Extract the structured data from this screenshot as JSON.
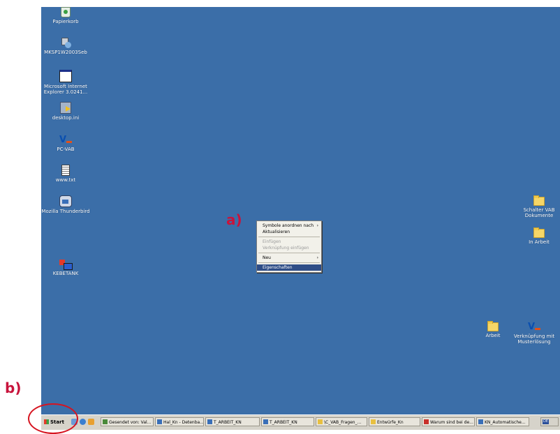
{
  "desktop_icons_left": [
    {
      "label": "Papierkorb",
      "icon": "recycle-bin-icon"
    },
    {
      "label": "MKSP1W2003Seb",
      "icon": "network-computer-icon"
    },
    {
      "label": "Microsoft Internet Explorer 3.0241...",
      "icon": "application-window-icon"
    },
    {
      "label": "desktop.ini",
      "icon": "config-file-icon"
    },
    {
      "label": "PC-VAB",
      "icon": "vr-bank-icon"
    },
    {
      "label": "www.txt",
      "icon": "text-file-icon"
    },
    {
      "label": "Mozilla Thunderbird",
      "icon": "thunderbird-icon"
    },
    {
      "label": "KEBETANK",
      "icon": "keyboard-tool-icon"
    }
  ],
  "desktop_icons_right": [
    {
      "label": "Schalter VAB Dokumente",
      "icon": "folder-icon"
    },
    {
      "label": "In Arbeit",
      "icon": "folder-icon"
    },
    {
      "label": "Arbeit",
      "icon": "folder-icon"
    },
    {
      "label": "Verknüpfung mit Musterlösung",
      "icon": "vr-bank-icon"
    }
  ],
  "context_menu": {
    "items": [
      {
        "label": "Symbole anordnen nach",
        "arrow": "›",
        "disabled": false,
        "selected": false
      },
      {
        "label": "Aktualisieren",
        "arrow": "",
        "disabled": false,
        "selected": false
      },
      {
        "label": "Einfügen",
        "arrow": "",
        "disabled": true,
        "selected": false
      },
      {
        "label": "Verknüpfung einfügen",
        "arrow": "",
        "disabled": true,
        "selected": false
      },
      {
        "label": "Neu",
        "arrow": "›",
        "disabled": false,
        "selected": false
      },
      {
        "label": "Eigenschaften",
        "arrow": "",
        "disabled": false,
        "selected": true
      }
    ]
  },
  "annotations": {
    "a": "a)",
    "b": "b)"
  },
  "taskbar": {
    "start_label": "Start",
    "buttons": [
      {
        "label": "Gesendet von: Val...",
        "icon_color": "#4a8a3a"
      },
      {
        "label": "Hal_Kn - Detenba...",
        "icon_color": "#3a6fb8"
      },
      {
        "label": "T_ARBEIT_KN",
        "icon_color": "#3a6fb8"
      },
      {
        "label": "T_ARBEIT_KN",
        "icon_color": "#3a6fb8"
      },
      {
        "label": "\\C_VAB_Fragen_...",
        "icon_color": "#e8c040"
      },
      {
        "label": "Entwürfe_Kn",
        "icon_color": "#e8c040"
      },
      {
        "label": "Warum sind bei de...",
        "icon_color": "#c8302a"
      },
      {
        "label": "KN_Automatische...",
        "icon_color": "#3a6fb8"
      }
    ],
    "tray_label": "DE"
  },
  "colors": {
    "desktop": "#3b6ea8",
    "menu_highlight": "#2e4d87",
    "annotation": "#c8143c"
  }
}
